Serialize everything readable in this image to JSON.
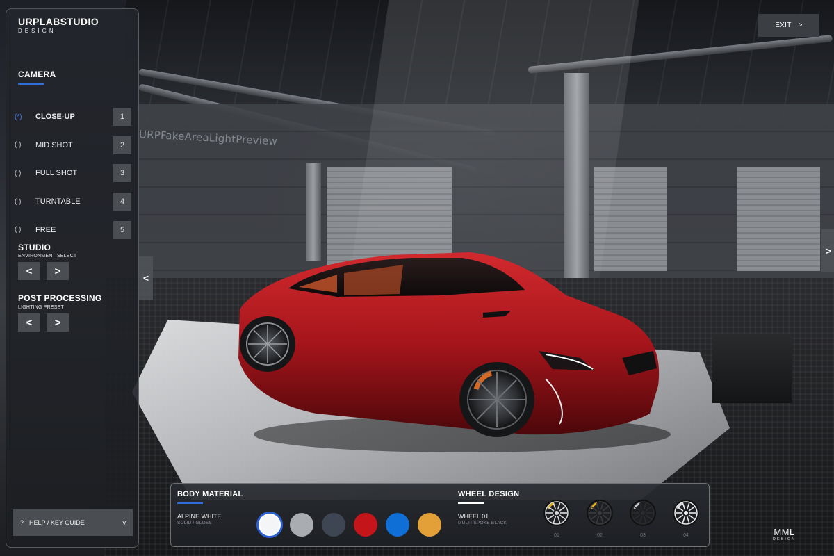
{
  "brand": {
    "name": "URPLABSTUDIO",
    "sub": "DESIGN"
  },
  "scene": {
    "watermark": "URPFakeAreaLightPreview"
  },
  "camera": {
    "title": "CAMERA",
    "options": [
      {
        "radio": "(*)",
        "label": "CLOSE-UP",
        "key": "1",
        "selected": true
      },
      {
        "radio": "( )",
        "label": "MID SHOT",
        "key": "2",
        "selected": false
      },
      {
        "radio": "( )",
        "label": "FULL SHOT",
        "key": "3",
        "selected": false
      },
      {
        "radio": "( )",
        "label": "TURNTABLE",
        "key": "4",
        "selected": false
      },
      {
        "radio": "( )",
        "label": "FREE",
        "key": "5",
        "selected": false
      }
    ]
  },
  "studio": {
    "title": "STUDIO",
    "subtitle": "ENVIRONMENT SELECT",
    "prev": "<",
    "next": ">"
  },
  "post": {
    "title": "POST PROCESSING",
    "subtitle": "LIGHTING PRESET",
    "prev": "<",
    "next": ">"
  },
  "help": {
    "icon": "?",
    "label": "HELP / KEY GUIDE",
    "chevron": "v"
  },
  "nav": {
    "left": "<",
    "right": ">"
  },
  "exit": {
    "label": "EXIT",
    "chevron": ">"
  },
  "body_material": {
    "title": "BODY MATERIAL",
    "value": "ALPINE WHITE",
    "sub": "SOLID / GLOSS",
    "swatches": [
      {
        "color": "#f4f5f7",
        "selected": true
      },
      {
        "color": "#a9acb1",
        "selected": false
      },
      {
        "color": "#3e4653",
        "selected": false
      },
      {
        "color": "#c4161a",
        "selected": false
      },
      {
        "color": "#0f6fd6",
        "selected": false
      },
      {
        "color": "#e4a038",
        "selected": false
      }
    ]
  },
  "wheel_design": {
    "title": "WHEEL DESIGN",
    "value": "WHEEL 01",
    "sub": "MULTI-SPOKE BLACK",
    "wheels": [
      {
        "num": "01",
        "caliper": "#e0b020",
        "rim": "#d9dcdf"
      },
      {
        "num": "02",
        "caliper": "#e0b020",
        "rim": "#3a3c40"
      },
      {
        "num": "03",
        "caliper": "#c8cbcf",
        "rim": "#2a2c2f"
      },
      {
        "num": "04",
        "caliper": "#d6d9dc",
        "rim": "#e9ebed"
      }
    ]
  },
  "logo": {
    "name": "MML",
    "sub": "DESIGN"
  },
  "colors": {
    "accent": "#2f6ed8",
    "car_paint": "#a5151b"
  }
}
